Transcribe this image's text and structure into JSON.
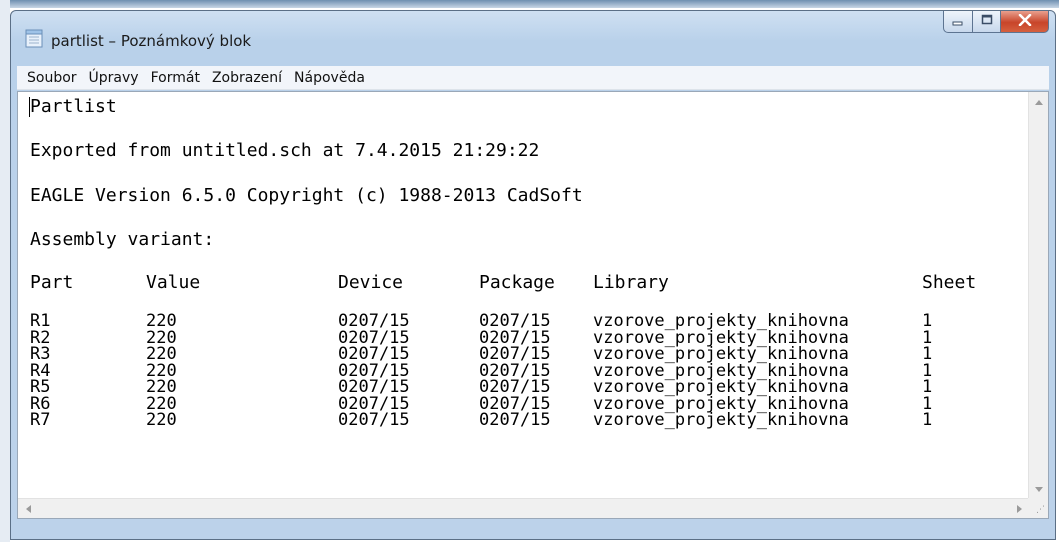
{
  "window": {
    "title": "partlist – Poznámkový blok",
    "icon": "notepad-icon",
    "controls": [
      "minimize-icon",
      "maximize-icon",
      "close-icon"
    ]
  },
  "menu": [
    "Soubor",
    "Úpravy",
    "Formát",
    "Zobrazení",
    "Nápověda"
  ],
  "document": {
    "heading": "Partlist",
    "exported": "Exported from untitled.sch at 7.4.2015 21:29:22",
    "version": "EAGLE Version 6.5.0 Copyright (c) 1988-2013 CadSoft",
    "variant": "Assembly variant:",
    "columns": [
      "Part",
      "Value",
      "Device",
      "Package",
      "Library",
      "Sheet"
    ],
    "rows": [
      [
        "R1",
        "220",
        "0207/15",
        "0207/15",
        "vzorove_projekty_knihovna",
        "1"
      ],
      [
        "R2",
        "220",
        "0207/15",
        "0207/15",
        "vzorove_projekty_knihovna",
        "1"
      ],
      [
        "R3",
        "220",
        "0207/15",
        "0207/15",
        "vzorove_projekty_knihovna",
        "1"
      ],
      [
        "R4",
        "220",
        "0207/15",
        "0207/15",
        "vzorove_projekty_knihovna",
        "1"
      ],
      [
        "R5",
        "220",
        "0207/15",
        "0207/15",
        "vzorove_projekty_knihovna",
        "1"
      ],
      [
        "R6",
        "220",
        "0207/15",
        "0207/15",
        "vzorove_projekty_knihovna",
        "1"
      ],
      [
        "R7",
        "220",
        "0207/15",
        "0207/15",
        "vzorove_projekty_knihovna",
        "1"
      ]
    ]
  },
  "colors": {
    "close": "#c8452a",
    "frame": "#b9d1ea",
    "text": "#000000"
  }
}
